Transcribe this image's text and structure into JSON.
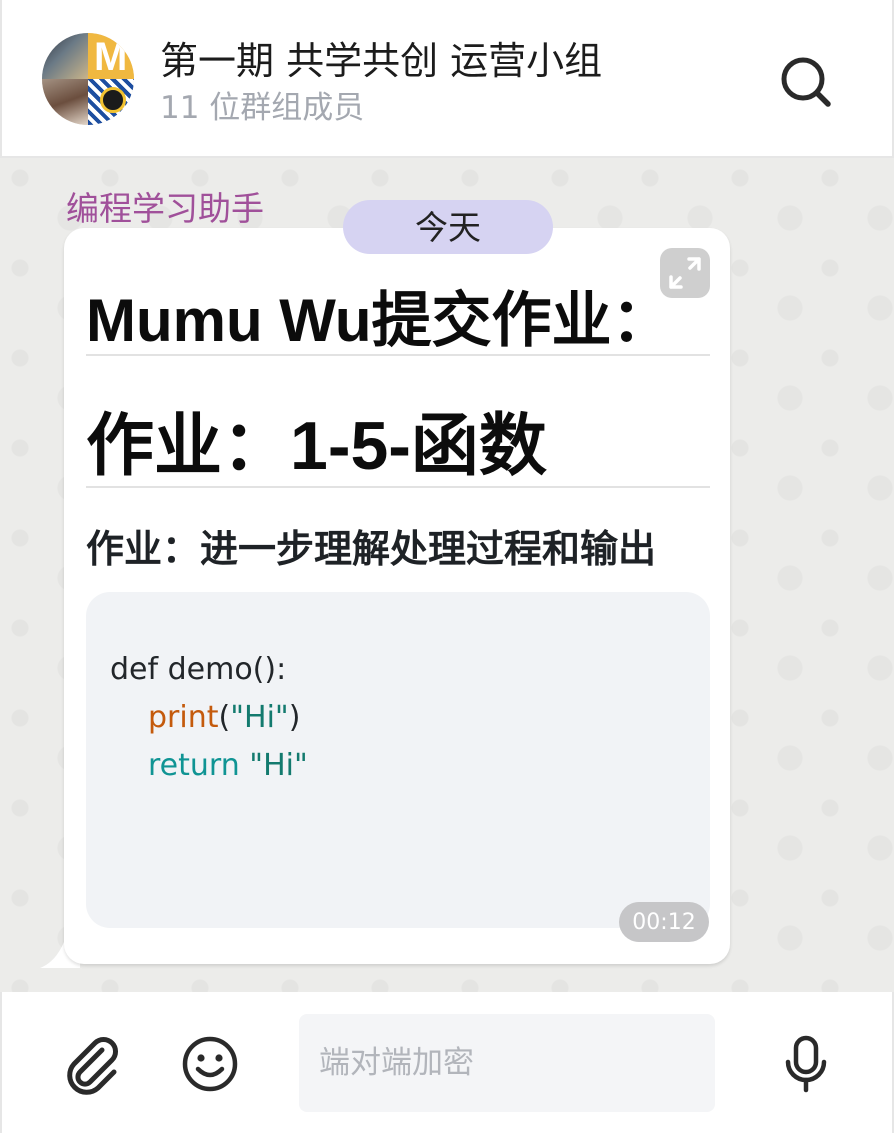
{
  "header": {
    "group_name": "第一期 共学共创 运营小组",
    "member_count": "11 位群组成员",
    "avatar_letter": "M",
    "search_icon": "search-icon"
  },
  "chat": {
    "date_divider": "今天",
    "message": {
      "sender": "编程学习助手",
      "heading1": "Mumu Wu提交作业：",
      "heading2": "作业：1-5-函数",
      "heading3": "作业：进一步理解处理过程和输出",
      "code": {
        "line1": "def demo():",
        "line2_fn": "print",
        "line2_open": "(",
        "line2_str": "\"Hi\"",
        "line2_close": ")",
        "line3_kw": "return",
        "line3_str": " \"Hi\""
      },
      "time": "00:12",
      "expand_icon": "expand-icon"
    }
  },
  "composer": {
    "placeholder": "端对端加密",
    "attach_icon": "paperclip-icon",
    "emoji_icon": "smiley-icon",
    "mic_icon": "microphone-icon"
  },
  "colors": {
    "sender": "#a0509a",
    "date_pill": "#d6d3f2",
    "chat_background": "#ececea",
    "code_background": "#f1f3f6",
    "code_function": "#c45a0c",
    "code_keyword": "#109494"
  }
}
